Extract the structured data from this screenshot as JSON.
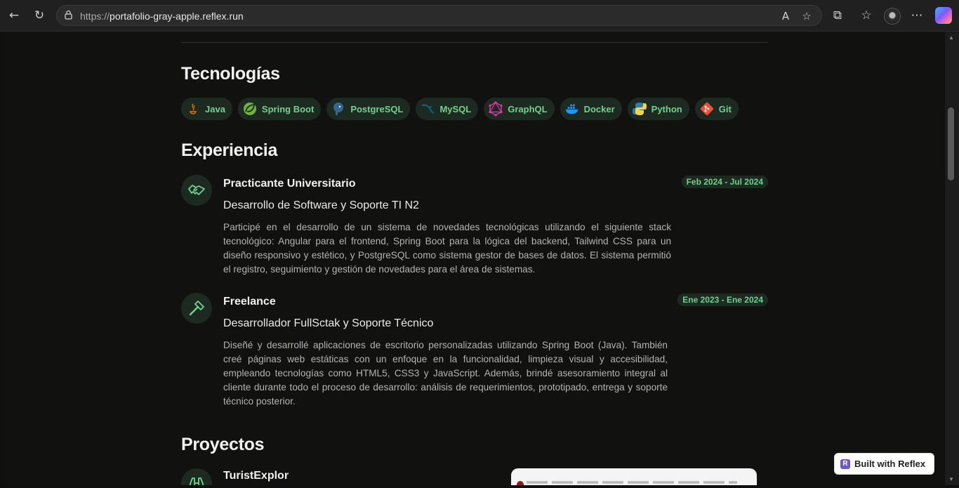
{
  "browser": {
    "url_protocol": "https://",
    "url_host": "portafolio-gray-apple.reflex.run"
  },
  "sections": {
    "tech_title": "Tecnologías",
    "exp_title": "Experiencia",
    "projects_title": "Proyectos"
  },
  "technologies": [
    {
      "label": "Java",
      "icon": "java-icon",
      "color": "#e76f00"
    },
    {
      "label": "Spring Boot",
      "icon": "spring-icon",
      "color": "#6db33f"
    },
    {
      "label": "PostgreSQL",
      "icon": "postgresql-icon",
      "color": "#336791"
    },
    {
      "label": "MySQL",
      "icon": "mysql-icon",
      "color": "#00758f"
    },
    {
      "label": "GraphQL",
      "icon": "graphql-icon",
      "color": "#e535ab"
    },
    {
      "label": "Docker",
      "icon": "docker-icon",
      "color": "#2496ed"
    },
    {
      "label": "Python",
      "icon": "python-icon",
      "color": "#ffd43b"
    },
    {
      "label": "Git",
      "icon": "git-icon",
      "color": "#f05032"
    }
  ],
  "experience": [
    {
      "title": "Practicante Universitario",
      "subtitle": "Desarrollo de Software y Soporte TI N2",
      "description": "Participé en el desarrollo de un sistema de novedades tecnológicas utilizando el siguiente stack tecnológico: Angular para el frontend, Spring Boot para la lógica del backend, Tailwind CSS para un diseño responsivo y estético, y PostgreSQL como sistema gestor de bases de datos. El sistema permitió el registro, seguimiento y gestión de novedades para el área de sistemas.",
      "date": "Feb 2024 - Jul 2024",
      "icon": "handshake-icon"
    },
    {
      "title": "Freelance",
      "subtitle": "Desarrollador FullSctak y Soporte Técnico",
      "description": "Diseñé y desarrollé aplicaciones de escritorio personalizadas utilizando Spring Boot (Java). También creé páginas web estáticas con un enfoque en la funcionalidad, limpieza visual y accesibilidad, empleando tecnologías como HTML5, CSS3 y JavaScript. Además, brindé asesoramiento integral al cliente durante todo el proceso de desarrollo: análisis de requerimientos, prototipado, entrega y soporte técnico posterior.",
      "date": "Ene 2023 - Ene 2024",
      "icon": "hammer-icon"
    }
  ],
  "project": {
    "title": "TuristExplor",
    "icon": "binoculars-icon"
  },
  "reflex_badge": "Built with Reflex",
  "colors": {
    "accent": "#6fd38b",
    "badge_bg": "#1d2a21",
    "bg": "#111110"
  }
}
